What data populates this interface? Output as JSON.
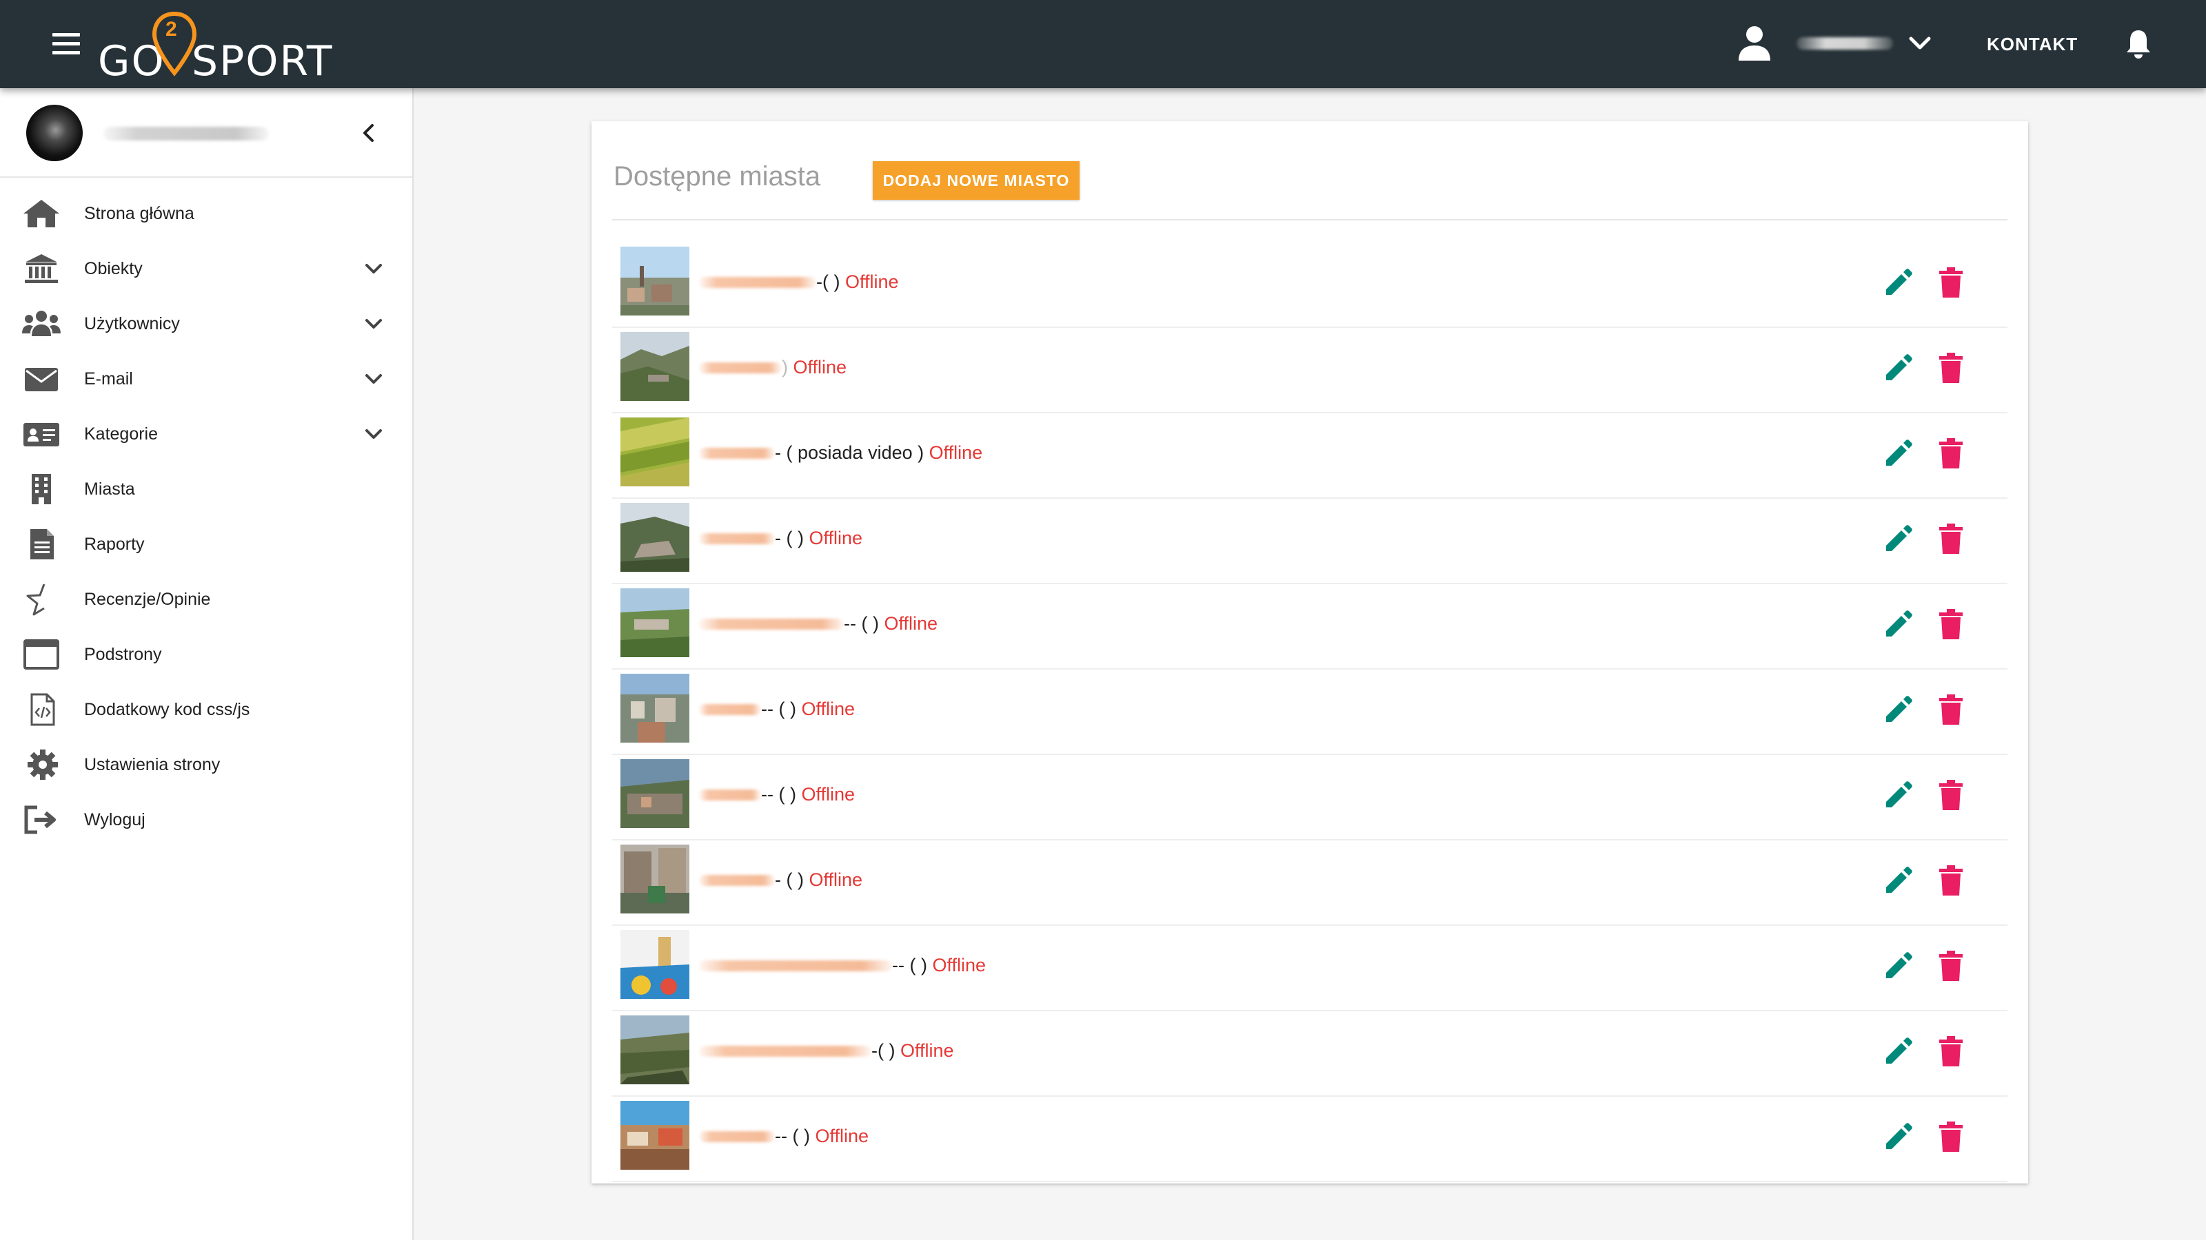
{
  "header": {
    "logo": {
      "left": "GO",
      "digit": "2",
      "right": "SPORT"
    },
    "user_name": "",
    "contact_label": "KONTAKT",
    "icons": [
      "menu-icon",
      "user-icon",
      "chevron-down-icon",
      "bell-icon"
    ],
    "background": "#263238"
  },
  "sidebar": {
    "profile_name": "",
    "items": [
      {
        "label": "Strona główna",
        "icon": "home-icon",
        "expandable": false
      },
      {
        "label": "Obiekty",
        "icon": "bank-icon",
        "expandable": true
      },
      {
        "label": "Użytkownicy",
        "icon": "users-icon",
        "expandable": true
      },
      {
        "label": "E-mail",
        "icon": "envelope-icon",
        "expandable": true
      },
      {
        "label": "Kategorie",
        "icon": "id-card-icon",
        "expandable": true
      },
      {
        "label": "Miasta",
        "icon": "building-icon",
        "expandable": false
      },
      {
        "label": "Raporty",
        "icon": "report-icon",
        "expandable": false
      },
      {
        "label": "Recenzje/Opinie",
        "icon": "star-half-icon",
        "expandable": false
      },
      {
        "label": "Podstrony",
        "icon": "window-icon",
        "expandable": false
      },
      {
        "label": "Dodatkowy kod css/js",
        "icon": "code-file-icon",
        "expandable": false
      },
      {
        "label": "Ustawienia strony",
        "icon": "gear-icon",
        "expandable": false
      },
      {
        "label": "Wyloguj",
        "icon": "sign-out-icon",
        "expandable": false
      }
    ]
  },
  "main": {
    "title": "Dostępne miasta",
    "add_button_label": "DODAJ NOWE MIASTO",
    "cities": [
      {
        "name": "",
        "extra": "-( )",
        "status": "Offline"
      },
      {
        "name": "",
        "extra": ")",
        "status": "Offline"
      },
      {
        "name": "",
        "extra": "- ( posiada video )",
        "status": "Offline"
      },
      {
        "name": "",
        "extra": "- ( )",
        "status": "Offline"
      },
      {
        "name": "",
        "extra": "-- ( )",
        "status": "Offline"
      },
      {
        "name": "",
        "extra": "-- ( )",
        "status": "Offline"
      },
      {
        "name": "",
        "extra": "-- ( )",
        "status": "Offline"
      },
      {
        "name": "",
        "extra": "- ( )",
        "status": "Offline"
      },
      {
        "name": "",
        "extra": "-- ( )",
        "status": "Offline"
      },
      {
        "name": "",
        "extra": "-( )",
        "status": "Offline"
      },
      {
        "name": "",
        "extra": "-- ( )",
        "status": "Offline"
      }
    ],
    "row_icons": [
      "pencil-icon",
      "trash-icon"
    ]
  },
  "colors": {
    "accent": "#f5a12a",
    "offline": "#e53935",
    "edit": "#00897b",
    "delete": "#e91e63",
    "title": "#9e9e9e"
  }
}
